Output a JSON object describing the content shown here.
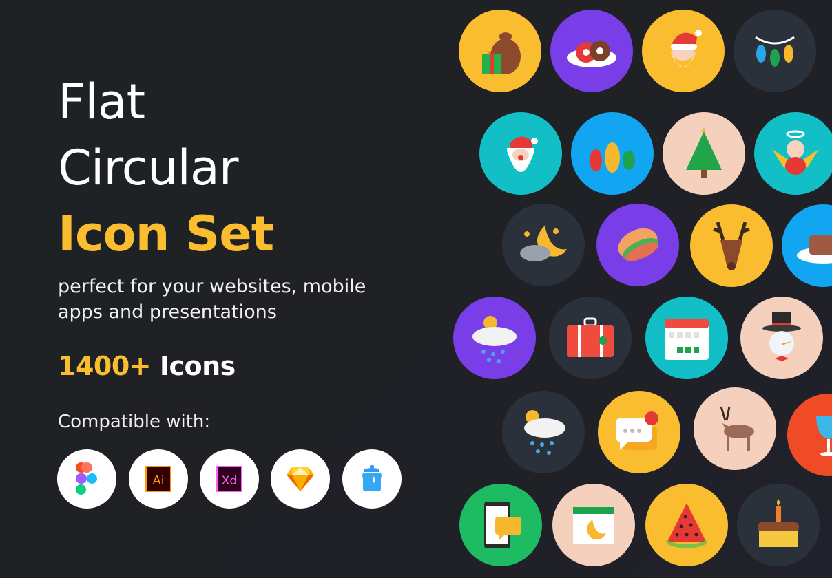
{
  "headline": {
    "line1": "Flat",
    "line2": "Circular",
    "line3": "Icon Set"
  },
  "subtitle": {
    "line1": "perfect for your websites, mobile",
    "line2": "apps and presentations"
  },
  "count": {
    "number": "1400+",
    "label": "Icons"
  },
  "compatible_label": "Compatible with:",
  "colors": {
    "accent": "#fbbd30",
    "background": "#1f2225",
    "yellow": "#fbbd30",
    "purple": "#7a3ee8",
    "teal": "#13bfc7",
    "blue": "#12a6f2",
    "peach": "#f4d0bd",
    "dark": "#2b313a",
    "green": "#1dbb62",
    "orange_red": "#ef4b26"
  },
  "apps": [
    {
      "name": "Figma",
      "icon": "figma-icon"
    },
    {
      "name": "Adobe Illustrator",
      "icon": "illustrator-icon",
      "text": "Ai"
    },
    {
      "name": "Adobe XD",
      "icon": "xd-icon",
      "text": "Xd"
    },
    {
      "name": "Sketch",
      "icon": "sketch-icon"
    },
    {
      "name": "Iconjar",
      "icon": "iconjar-icon"
    }
  ],
  "icon_tiles": [
    {
      "icon": "santa-sack-gift-icon",
      "bg": "yellow"
    },
    {
      "icon": "donuts-plate-icon",
      "bg": "purple"
    },
    {
      "icon": "santa-face-icon",
      "bg": "yellow"
    },
    {
      "icon": "christmas-lights-icon",
      "bg": "dark"
    },
    {
      "icon": "santa-claus-icon",
      "bg": "teal"
    },
    {
      "icon": "christmas-ornaments-icon",
      "bg": "blue"
    },
    {
      "icon": "christmas-tree-icon",
      "bg": "peach"
    },
    {
      "icon": "angel-icon",
      "bg": "teal"
    },
    {
      "icon": "moon-cloud-night-icon",
      "bg": "dark"
    },
    {
      "icon": "sandwich-icon",
      "bg": "purple"
    },
    {
      "icon": "reindeer-head-icon",
      "bg": "yellow"
    },
    {
      "icon": "bread-plate-icon",
      "bg": "blue"
    },
    {
      "icon": "sun-rain-cloud-icon",
      "bg": "purple"
    },
    {
      "icon": "suitcase-icon",
      "bg": "dark"
    },
    {
      "icon": "calendar-icon",
      "bg": "teal"
    },
    {
      "icon": "snowman-icon",
      "bg": "peach"
    },
    {
      "icon": "rain-cloud-sun-icon",
      "bg": "dark"
    },
    {
      "icon": "chat-notification-icon",
      "bg": "yellow"
    },
    {
      "icon": "deer-icon",
      "bg": "peach"
    },
    {
      "icon": "wine-glass-icon",
      "bg": "orange_red"
    },
    {
      "icon": "phone-message-icon",
      "bg": "green"
    },
    {
      "icon": "ramadan-calendar-icon",
      "bg": "peach"
    },
    {
      "icon": "watermelon-icon",
      "bg": "yellow"
    },
    {
      "icon": "birthday-cake-icon",
      "bg": "dark"
    }
  ]
}
